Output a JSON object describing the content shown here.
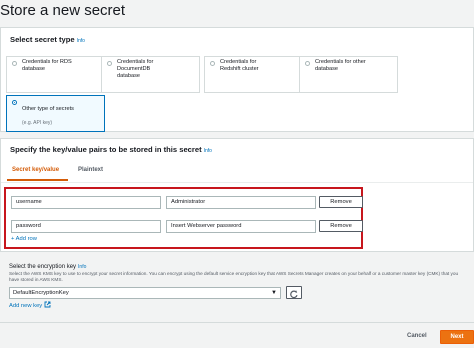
{
  "page": {
    "title": "Store a new secret"
  },
  "secret_type": {
    "heading": "Select secret type",
    "info": "Info",
    "options": [
      {
        "label": "Credentials for RDS\ndatabase",
        "sub": "",
        "selected": false
      },
      {
        "label": "Credentials for\nDocumentDB\ndatabase",
        "sub": "",
        "selected": false
      },
      {
        "label": "Credentials for\nRedshift cluster",
        "sub": "",
        "selected": false
      },
      {
        "label": "Credentials for other\ndatabase",
        "sub": "",
        "selected": false
      },
      {
        "label": "Other type of secrets",
        "sub": "(e.g. API key)",
        "selected": true
      }
    ]
  },
  "kv": {
    "heading": "Specify the key/value pairs to be stored in this secret",
    "info": "Info",
    "tabs": [
      {
        "label": "Secret key/value",
        "active": true
      },
      {
        "label": "Plaintext",
        "active": false
      }
    ],
    "rows": [
      {
        "key": "username",
        "value": "Administrator",
        "remove": "Remove"
      },
      {
        "key": "password",
        "value": "Insert Webserver password",
        "remove": "Remove"
      }
    ],
    "add_row": "+ Add row"
  },
  "encryption": {
    "label": "Select the encryption key",
    "info": "Info",
    "description": "Select the AWS KMS key to use to encrypt your secret information. You can encrypt using the default service encryption key that AWS Secrets Manager creates on your behalf or a customer master key (CMK) that you have stored in AWS KMS.",
    "selected": "DefaultEncryptionKey",
    "add_new_key": "Add new key"
  },
  "footer": {
    "cancel": "Cancel",
    "next": "Next"
  },
  "colors": {
    "accent": "#ec7211",
    "link": "#0073bb",
    "highlight": "#c7161d"
  }
}
